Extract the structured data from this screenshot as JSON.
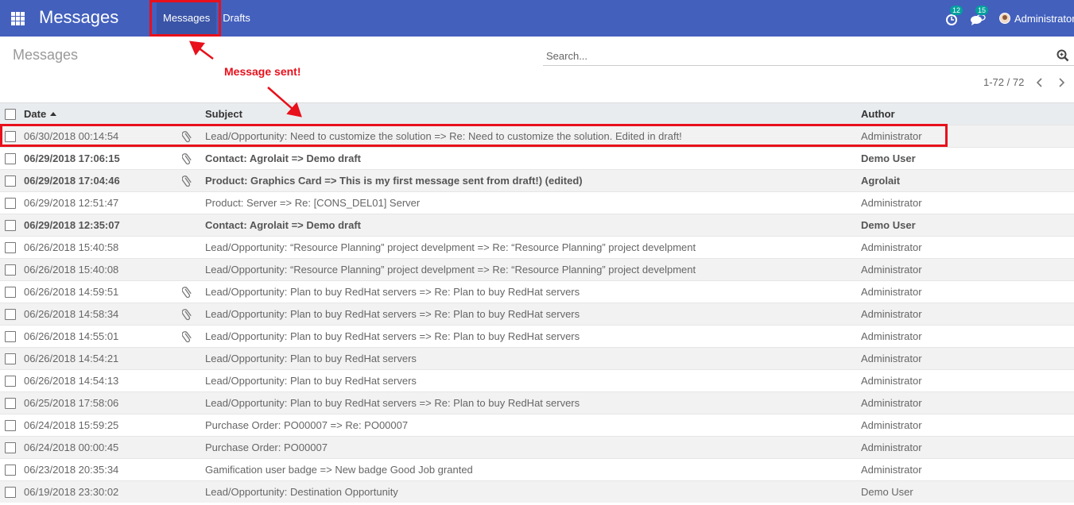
{
  "navbar": {
    "app_title": "Messages",
    "menu": [
      "Messages",
      "Drafts"
    ],
    "activity_count": "12",
    "discuss_count": "15",
    "user_name": "Administrator"
  },
  "control_panel": {
    "breadcrumb": "Messages",
    "search_placeholder": "Search...",
    "pager": "1-72 / 72"
  },
  "list": {
    "columns": {
      "date": "Date",
      "subject": "Subject",
      "author": "Author"
    },
    "rows": [
      {
        "date": "06/30/2018 00:14:54",
        "subject": "Lead/Opportunity: Need to customize the solution => Re: Need to customize the solution. Edited in draft!",
        "author": "Administrator",
        "bold": false,
        "attachment": true
      },
      {
        "date": "06/29/2018 17:06:15",
        "subject": "Contact: Agrolait => Demo draft",
        "author": "Demo User",
        "bold": true,
        "attachment": true
      },
      {
        "date": "06/29/2018 17:04:46",
        "subject": "Product: Graphics Card => This is my first message sent from draft!) (edited)",
        "author": "Agrolait",
        "bold": true,
        "attachment": true
      },
      {
        "date": "06/29/2018 12:51:47",
        "subject": "Product: Server => Re: [CONS_DEL01] Server",
        "author": "Administrator",
        "bold": false,
        "attachment": false
      },
      {
        "date": "06/29/2018 12:35:07",
        "subject": "Contact: Agrolait => Demo draft",
        "author": "Demo User",
        "bold": true,
        "attachment": false
      },
      {
        "date": "06/26/2018 15:40:58",
        "subject": "Lead/Opportunity: “Resource Planning” project develpment => Re: “Resource Planning” project develpment",
        "author": "Administrator",
        "bold": false,
        "attachment": false
      },
      {
        "date": "06/26/2018 15:40:08",
        "subject": "Lead/Opportunity: “Resource Planning” project develpment => Re: “Resource Planning” project develpment",
        "author": "Administrator",
        "bold": false,
        "attachment": false
      },
      {
        "date": "06/26/2018 14:59:51",
        "subject": "Lead/Opportunity: Plan to buy RedHat servers => Re: Plan to buy RedHat servers",
        "author": "Administrator",
        "bold": false,
        "attachment": true
      },
      {
        "date": "06/26/2018 14:58:34",
        "subject": "Lead/Opportunity: Plan to buy RedHat servers => Re: Plan to buy RedHat servers",
        "author": "Administrator",
        "bold": false,
        "attachment": true
      },
      {
        "date": "06/26/2018 14:55:01",
        "subject": "Lead/Opportunity: Plan to buy RedHat servers => Re: Plan to buy RedHat servers",
        "author": "Administrator",
        "bold": false,
        "attachment": true
      },
      {
        "date": "06/26/2018 14:54:21",
        "subject": "Lead/Opportunity: Plan to buy RedHat servers",
        "author": "Administrator",
        "bold": false,
        "attachment": false
      },
      {
        "date": "06/26/2018 14:54:13",
        "subject": "Lead/Opportunity: Plan to buy RedHat servers",
        "author": "Administrator",
        "bold": false,
        "attachment": false
      },
      {
        "date": "06/25/2018 17:58:06",
        "subject": "Lead/Opportunity: Plan to buy RedHat servers => Re: Plan to buy RedHat servers",
        "author": "Administrator",
        "bold": false,
        "attachment": false
      },
      {
        "date": "06/24/2018 15:59:25",
        "subject": "Purchase Order: PO00007 => Re: PO00007",
        "author": "Administrator",
        "bold": false,
        "attachment": false
      },
      {
        "date": "06/24/2018 00:00:45",
        "subject": "Purchase Order: PO00007",
        "author": "Administrator",
        "bold": false,
        "attachment": false
      },
      {
        "date": "06/23/2018 20:35:34",
        "subject": "Gamification user badge => New badge Good Job granted",
        "author": "Administrator",
        "bold": false,
        "attachment": false
      },
      {
        "date": "06/19/2018 23:30:02",
        "subject": "Lead/Opportunity: Destination Opportunity",
        "author": "Demo User",
        "bold": false,
        "attachment": false
      }
    ]
  },
  "annotation": {
    "text": "Message sent!",
    "color": "#e8101b"
  },
  "colors": {
    "navbar": "#4360bd",
    "badge": "#00a09d"
  },
  "icons": [
    "apps-icon",
    "activity-icon",
    "discuss-icon",
    "search-icon",
    "chevron-left-icon",
    "chevron-right-icon",
    "paperclip-icon"
  ]
}
